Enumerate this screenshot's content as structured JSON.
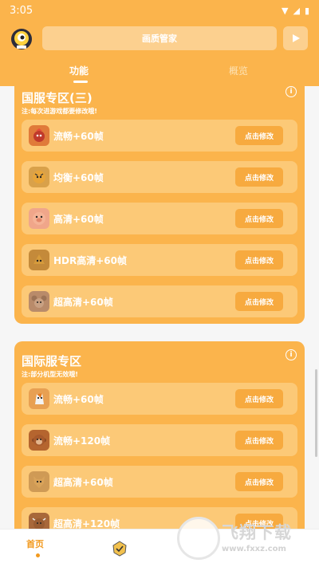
{
  "status": {
    "time": "3:05"
  },
  "header": {
    "title": "画质管家"
  },
  "tabs": [
    {
      "label": "功能"
    },
    {
      "label": "概览"
    }
  ],
  "section_cn": {
    "title": "国服专区(三)",
    "note": "注:每次进游戏都要修改哦!",
    "items": [
      {
        "label": "流畅+60帧",
        "button": "点击修改",
        "icon": "rooster-icon"
      },
      {
        "label": "均衡+60帧",
        "button": "点击修改",
        "icon": "tiger-icon"
      },
      {
        "label": "高清+60帧",
        "button": "点击修改",
        "icon": "pig-icon"
      },
      {
        "label": "HDR高清+60帧",
        "button": "点击修改",
        "icon": "dragon-icon"
      },
      {
        "label": "超高清+60帧",
        "button": "点击修改",
        "icon": "mouse-icon"
      }
    ]
  },
  "section_intl": {
    "title": "国际服专区",
    "note": "注:部分机型无效哦!",
    "items": [
      {
        "label": "流畅+60帧",
        "button": "点击修改",
        "icon": "horse-icon"
      },
      {
        "label": "流畅+120帧",
        "button": "点击修改",
        "icon": "monkey-icon"
      },
      {
        "label": "超高清+60帧",
        "button": "点击修改",
        "icon": "dog-icon"
      },
      {
        "label": "超高清+120帧",
        "button": "点击修改",
        "icon": "ox-icon"
      }
    ]
  },
  "bottom_nav": {
    "home": "首页"
  },
  "watermark": {
    "text": "飞翔下载",
    "url": "www.fxxz.com"
  },
  "colors": {
    "accent": "#fbb44c",
    "row": "#fcc977",
    "button": "#f7aa3f",
    "nav_active": "#f29a1f"
  }
}
